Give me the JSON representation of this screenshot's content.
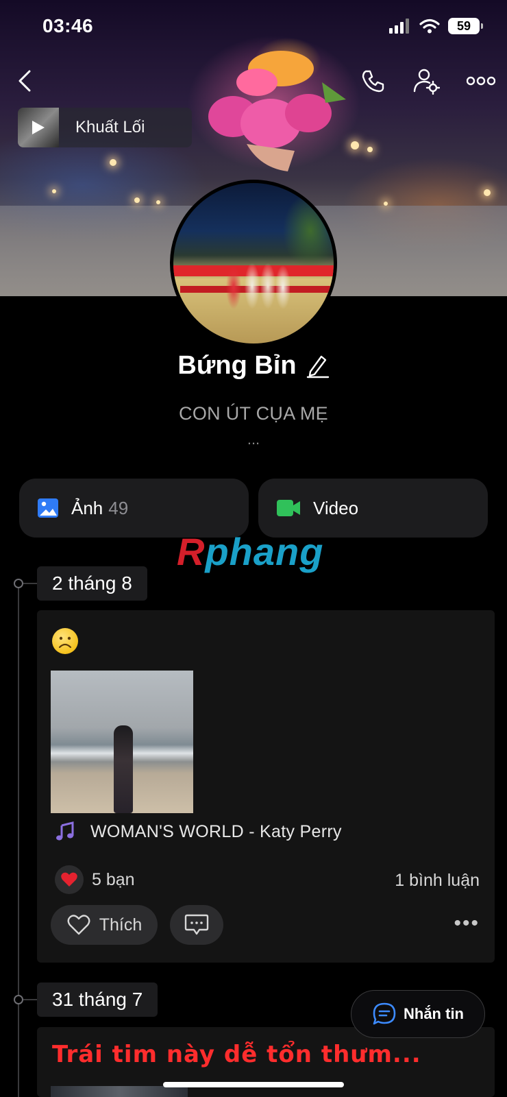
{
  "status_bar": {
    "time": "03:46",
    "battery": "59"
  },
  "cover": {
    "music_title": "Khuất Lối"
  },
  "profile": {
    "name": "Bứng Bỉn",
    "bio": "CON ÚT CỤA MẸ",
    "more": "..."
  },
  "media": {
    "photos_label": "Ảnh",
    "photos_count": "49",
    "video_label": "Video"
  },
  "watermark": {
    "part1": "R",
    "part2": "phang"
  },
  "timeline": [
    {
      "date": "2 tháng 8",
      "music": "WOMAN'S WORLD - Katy Perry",
      "likes": "5 bạn",
      "comments": "1 bình luận",
      "like_label": "Thích",
      "more": "•••"
    },
    {
      "date": "31 tháng 7",
      "text": "Trái tim này dễ tổn thưm..."
    }
  ],
  "chat_button": {
    "label": "Nhắn tin"
  },
  "colors": {
    "background": "#000000",
    "card": "#1c1c1e",
    "accent_blue": "#2f7bf6",
    "video_green": "#30c15a",
    "caption_red": "#ff2d2d"
  }
}
